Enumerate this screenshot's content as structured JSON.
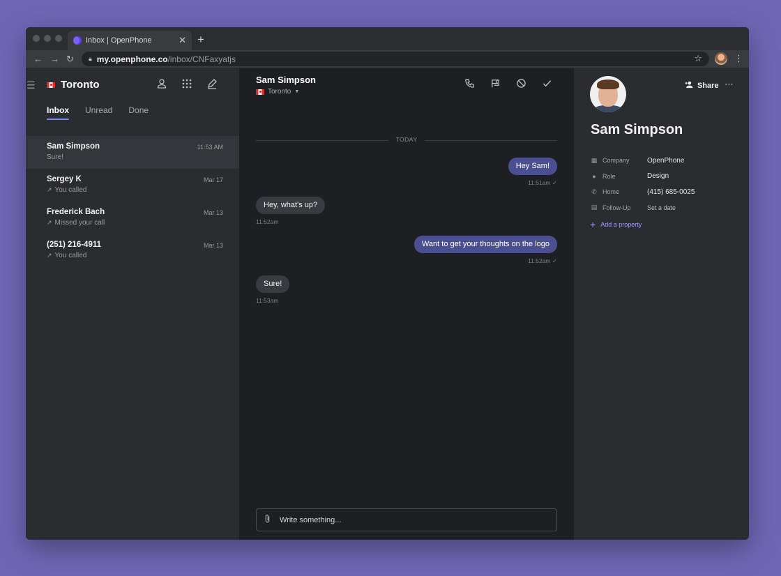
{
  "browser": {
    "tab_title": "Inbox | OpenPhone",
    "url_host": "my.openphone.co",
    "url_path": "/inbox/CNFaxyatjs"
  },
  "sidebar": {
    "team_name": "Toronto",
    "tabs": [
      {
        "label": "Inbox",
        "active": true
      },
      {
        "label": "Unread",
        "active": false
      },
      {
        "label": "Done",
        "active": false
      }
    ],
    "conversations": [
      {
        "name": "Sam Simpson",
        "snippet": "Sure!",
        "time": "11:53 AM",
        "arrow": ""
      },
      {
        "name": "Sergey K",
        "snippet": "You called",
        "time": "Mar 17",
        "arrow": "↗"
      },
      {
        "name": "Frederick Bach",
        "snippet": "Missed your call",
        "time": "Mar 13",
        "arrow": "↗"
      },
      {
        "name": "(251) 216-4911",
        "snippet": "You called",
        "time": "Mar 13",
        "arrow": "↗"
      }
    ]
  },
  "chat": {
    "contact_name": "Sam Simpson",
    "inbox": "Toronto",
    "divider": "TODAY",
    "messages": [
      {
        "text": "Hey Sam!",
        "time": "11:51am ✓",
        "direction": "out"
      },
      {
        "text": "Hey, what's up?",
        "time": "11:52am",
        "direction": "in"
      },
      {
        "text": "Want to get your thoughts on the logo",
        "time": "11:52am ✓",
        "direction": "out"
      },
      {
        "text": "Sure!",
        "time": "11:53am",
        "direction": "in"
      }
    ],
    "composer_placeholder": "Write something..."
  },
  "details": {
    "share_label": "Share",
    "name": "Sam Simpson",
    "properties": [
      {
        "key": "Company",
        "value": "OpenPhone",
        "icon": "building-icon"
      },
      {
        "key": "Role",
        "value": "Design",
        "icon": "person-icon"
      },
      {
        "key": "Home",
        "value": "(415) 685-0025",
        "icon": "phone-icon"
      },
      {
        "key": "Follow-Up",
        "value": "Set a date",
        "icon": "calendar-icon"
      }
    ],
    "add_property_label": "Add a property"
  },
  "colors": {
    "background": "#6f67b5",
    "accent": "#7b8cff",
    "outgoing_bubble": "#4b4f8f"
  }
}
